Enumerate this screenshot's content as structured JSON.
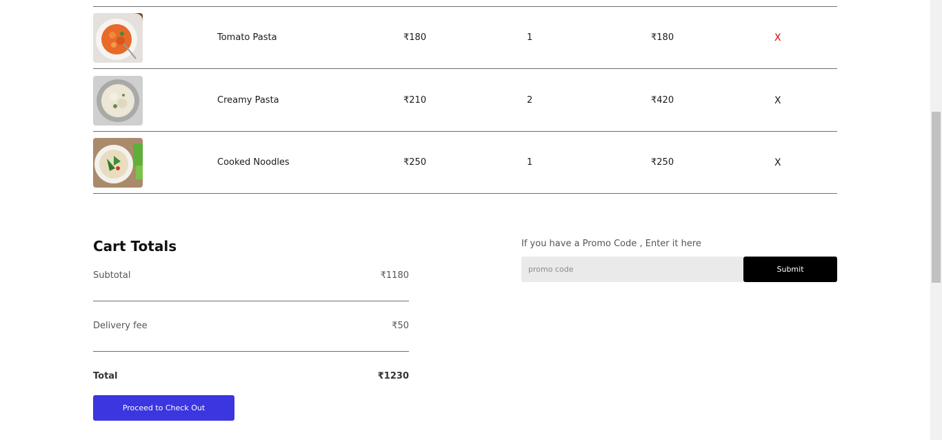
{
  "cart": {
    "items": [
      {
        "name": "Tomato Pasta",
        "price": "₹180",
        "quantity": "1",
        "total": "₹180",
        "remove": "X"
      },
      {
        "name": "Creamy Pasta",
        "price": "₹210",
        "quantity": "2",
        "total": "₹420",
        "remove": "X"
      },
      {
        "name": "Cooked Noodles",
        "price": "₹250",
        "quantity": "1",
        "total": "₹250",
        "remove": "X"
      }
    ]
  },
  "totals": {
    "title": "Cart Totals",
    "subtotal_label": "Subtotal",
    "subtotal_value": "₹1180",
    "delivery_label": "Delivery fee",
    "delivery_value": "₹50",
    "total_label": "Total",
    "total_value": "₹1230",
    "checkout_label": "Proceed to Check Out"
  },
  "promo": {
    "label": "If you have a Promo Code , Enter it here",
    "placeholder": "promo code",
    "value": "",
    "submit_label": "Submit"
  },
  "colors": {
    "checkout_button": "#3b36df",
    "remove_highlight": "#e00000",
    "submit_button": "#000000"
  },
  "icons": {
    "remove": "close-icon"
  }
}
